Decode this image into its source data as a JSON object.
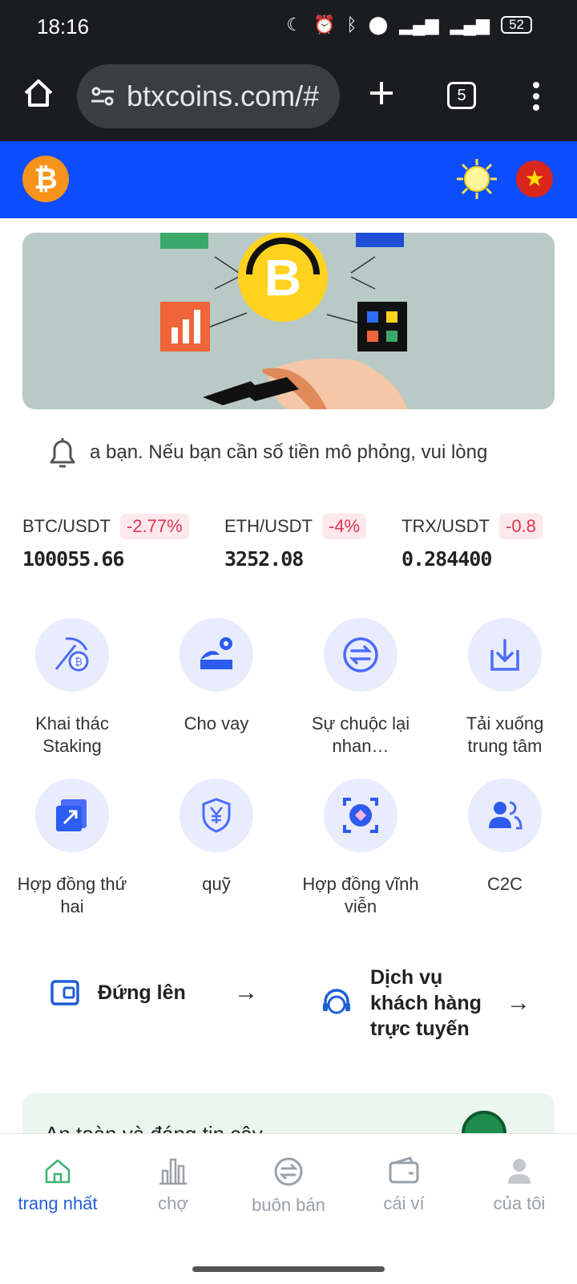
{
  "status_bar": {
    "time": "18:16",
    "battery": "52"
  },
  "browser": {
    "url": "btxcoins.com/#",
    "tab_count": "5"
  },
  "notice": {
    "text": "a bạn. Nếu bạn cần số tiền mô phỏng, vui lòng"
  },
  "tickers": [
    {
      "pair": "BTC/USDT",
      "change": "-2.77%",
      "price": "100055.66"
    },
    {
      "pair": "ETH/USDT",
      "change": "-4%",
      "price": "3252.08"
    },
    {
      "pair": "TRX/USDT",
      "change": "-0.8",
      "price": "0.284400"
    }
  ],
  "features": [
    {
      "label": "Khai thác Staking",
      "icon": "pickaxe-coin-icon"
    },
    {
      "label": "Cho vay",
      "icon": "loan-icon"
    },
    {
      "label": "Sự chuộc lại nhan…",
      "icon": "exchange-icon"
    },
    {
      "label": "Tải xuống trung tâm",
      "icon": "download-icon"
    },
    {
      "label": "Hợp đồng thứ hai",
      "icon": "contract-icon"
    },
    {
      "label": "quỹ",
      "icon": "yen-shield-icon"
    },
    {
      "label": "Hợp đồng vĩnh viễn",
      "icon": "perpetual-icon"
    },
    {
      "label": "C2C",
      "icon": "users-icon"
    }
  ],
  "actions": {
    "deposit": "Đứng lên",
    "support": "Dịch vụ khách hàng trực tuyến"
  },
  "safety": {
    "text": "An toàn và đáng tin cậy"
  },
  "nav": [
    {
      "label": "trang nhất",
      "icon": "home-icon",
      "active": true
    },
    {
      "label": "chợ",
      "icon": "market-chart-icon",
      "active": false
    },
    {
      "label": "buôn bán",
      "icon": "trade-icon",
      "active": false
    },
    {
      "label": "cái ví",
      "icon": "wallet-icon",
      "active": false
    },
    {
      "label": "của tôi",
      "icon": "profile-icon",
      "active": false
    }
  ],
  "colors": {
    "brand_blue": "#0b4dff",
    "negative": "#e0354f",
    "active_nav": "#1f5fd6"
  }
}
